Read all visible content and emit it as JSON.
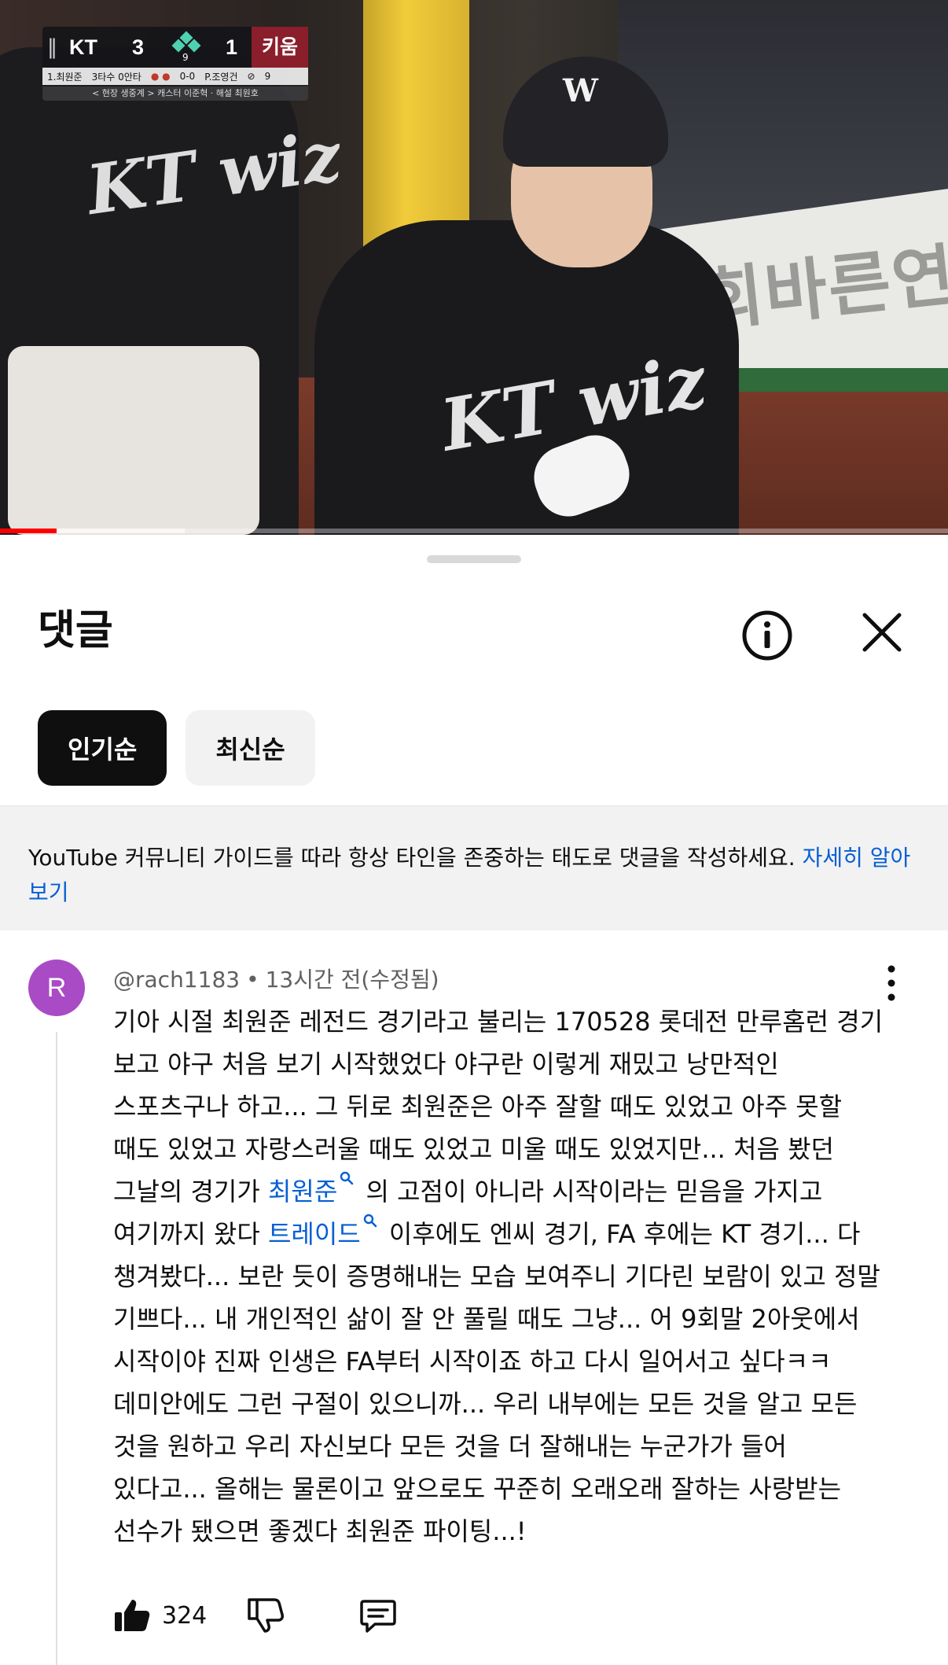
{
  "video": {
    "scorebug": {
      "away_team": "KT",
      "away_score": "3",
      "inning": "9",
      "home_score": "1",
      "home_team": "키움",
      "batter": "1.최원준",
      "batter_stat": "3타수 0안타",
      "count": "0-0",
      "pitcher": "P.조영건",
      "pitch_count": "9",
      "broadcast_info": "< 현장 생중계 > 캐스터 이준혁 · 해설 최원호"
    },
    "banner_text": "우회바른연",
    "jersey_text": "KT wiz",
    "progress": {
      "played_fraction": 0.06,
      "buffered_fraction": 0.195
    }
  },
  "sheet": {
    "title": "댓글",
    "tabs": [
      {
        "label": "인기순",
        "active": true
      },
      {
        "label": "최신순",
        "active": false
      }
    ],
    "guideline": {
      "text": "YouTube 커뮤니티 가이드를 따라 항상 타인을 존중하는 태도로 댓글을 작성하세요.",
      "link": "자세히 알아보기"
    }
  },
  "comment": {
    "avatar_letter": "R",
    "author": "@rach1183",
    "time": "13시간 전(수정됨)",
    "text_part1": "기아 시절 최원준 레전드 경기라고 불리는 170528 롯데전 만루홈런 경기 보고 야구 처음 보기 시작했었다 야구란 이렇게 재밌고 낭만적인 스포츠구나 하고... 그 뒤로 최원준은 아주 잘할 때도 있었고 아주 못할 때도 있었고 자랑스러울 때도 있었고 미울 때도 있었지만... 처음 봤던 그날의 경기가 ",
    "keyword1": "최원준",
    "text_part2": " 의 고점이 아니라 시작이라는 믿음을 가지고 여기까지 왔다 ",
    "keyword2": "트레이드",
    "text_part3": " 이후에도 엔씨 경기, FA 후에는 KT 경기... 다 챙겨봤다... 보란 듯이 증명해내는 모습 보여주니 기다린 보람이 있고 정말 기쁘다... 내 개인적인 삶이 잘 안 풀릴 때도 그냥... 어 9회말 2아웃에서 시작이야 진짜 인생은 FA부터 시작이죠 하고 다시 일어서고 싶다ㅋㅋ 데미안에도 그런 구절이 있으니까... 우리 내부에는 모든 것을 알고 모든 것을 원하고 우리 자신보다 모든 것을 더 잘해내는 누군가가 들어 있다고... 올해는 물론이고 앞으로도 꾸준히 오래오래 잘하는 사랑받는 선수가 됐으면 좋겠다 최원준 파이팅...!",
    "likes": "324",
    "separator": "•"
  },
  "icons": {
    "info": "info-icon",
    "close": "close-icon",
    "more": "more-vert-icon",
    "like": "thumb-up-icon",
    "dislike": "thumb-down-icon",
    "reply": "reply-icon",
    "search": "search-icon"
  },
  "colors": {
    "link": "#065fd4",
    "avatar": "#a94bc4",
    "progress_played": "#ff0000",
    "chip_active": "#0f0f0f"
  }
}
